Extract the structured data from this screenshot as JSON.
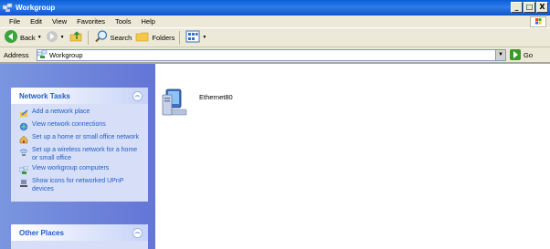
{
  "window": {
    "title": "Workgroup",
    "buttons": [
      "_",
      "□",
      "X"
    ]
  },
  "menu": [
    "File",
    "Edit",
    "View",
    "Favorites",
    "Tools",
    "Help"
  ],
  "toolbar": {
    "back_label": "Back",
    "search_label": "Search",
    "folders_label": "Folders"
  },
  "address": {
    "label": "Address",
    "value": "Workgroup",
    "go_label": "Go"
  },
  "network_tasks": {
    "title": "Network Tasks",
    "items": [
      {
        "label": "Add a network place",
        "icon": "add-network-place-icon"
      },
      {
        "label": "View network connections",
        "icon": "network-connections-icon"
      },
      {
        "label": "Set up a home or small office network",
        "icon": "home-network-icon"
      },
      {
        "label": "Set up a wireless network for a home or small office",
        "icon": "wireless-network-icon"
      },
      {
        "label": "View workgroup computers",
        "icon": "workgroup-computers-icon"
      },
      {
        "label": "Show icons for networked UPnP devices",
        "icon": "upnp-devices-icon"
      }
    ]
  },
  "other_places": {
    "title": "Other Places"
  },
  "main": {
    "items": [
      {
        "label": "Ethernet80",
        "icon": "computer-icon"
      }
    ]
  }
}
